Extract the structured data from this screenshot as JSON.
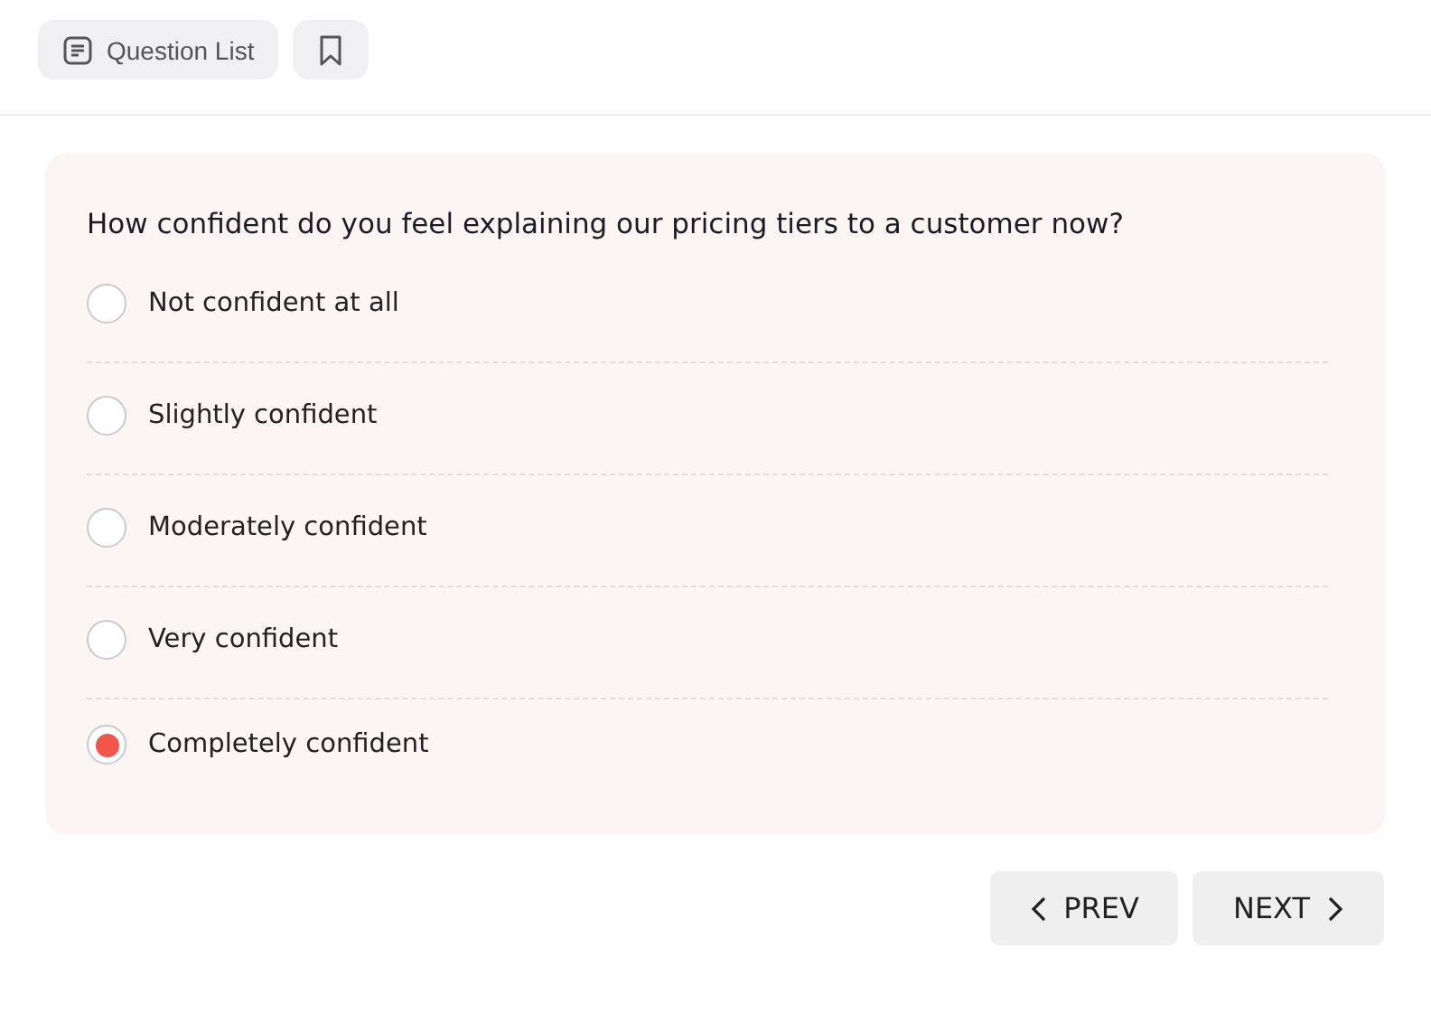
{
  "toolbar": {
    "question_list_button": "Question List"
  },
  "question": {
    "text": "How confident do you feel explaining our pricing tiers to a customer now?",
    "options": [
      {
        "label": "Not confident at all",
        "selected": false
      },
      {
        "label": "Slightly confident",
        "selected": false
      },
      {
        "label": "Moderately confident",
        "selected": false
      },
      {
        "label": "Very confident",
        "selected": false
      },
      {
        "label": "Completely confident",
        "selected": true
      }
    ]
  },
  "navigation": {
    "prev": "PREV",
    "next": "NEXT"
  }
}
